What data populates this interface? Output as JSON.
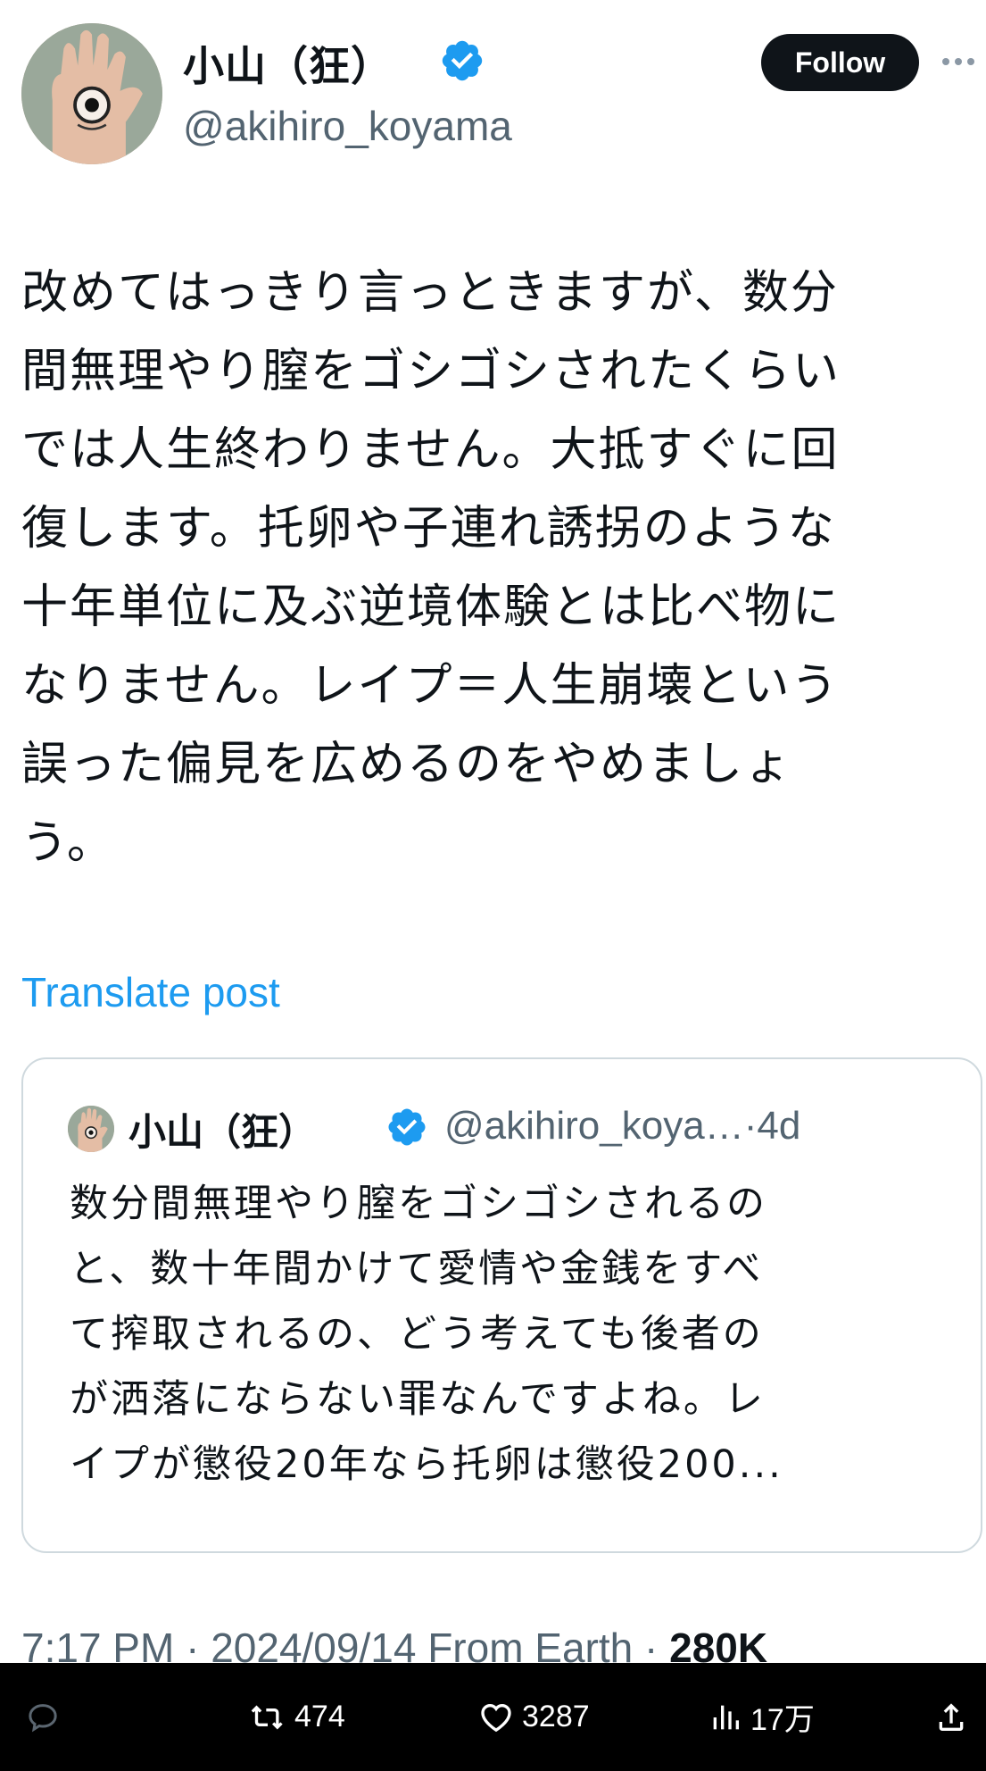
{
  "author": {
    "display_name": "小山（狂）",
    "handle": "@akihiro_koyama",
    "verified": true
  },
  "follow_button": "Follow",
  "post": {
    "text_lines": [
      "改めてはっきり言っときますが、数分",
      "間無理やり膣をゴシゴシされたくらい",
      "では人生終わりません。大抵すぐに回",
      "復します。托卵や子連れ誘拐のような",
      "十年単位に及ぶ逆境体験とは比べ物に",
      "なりません。レイプ＝人生崩壊という",
      "誤った偏見を広めるのをやめましょ",
      "う。"
    ]
  },
  "translate_label": "Translate post",
  "quote": {
    "display_name": "小山（狂）",
    "handle_time": "@akihiro_koya…·4d",
    "text_lines": [
      "数分間無理やり膣をゴシゴシされるの",
      "と、数十年間かけて愛情や金銭をすべ",
      "て搾取されるの、どう考えても後者の",
      "が洒落にならない罪なんですよね。レ",
      "イプが懲役20年なら托卵は懲役200..."
    ]
  },
  "meta": {
    "time_date": "7:17 PM · 2024/09/14 From Earth · ",
    "views": "280K"
  },
  "actions": {
    "reply_count": "",
    "retweet_count": "474",
    "like_count": "3287",
    "views_count": "17万"
  },
  "colors": {
    "accent": "#1d9bf0",
    "text": "#0f1419",
    "muted": "#536471",
    "border": "#cfd9de",
    "action_bar": "#000000"
  }
}
